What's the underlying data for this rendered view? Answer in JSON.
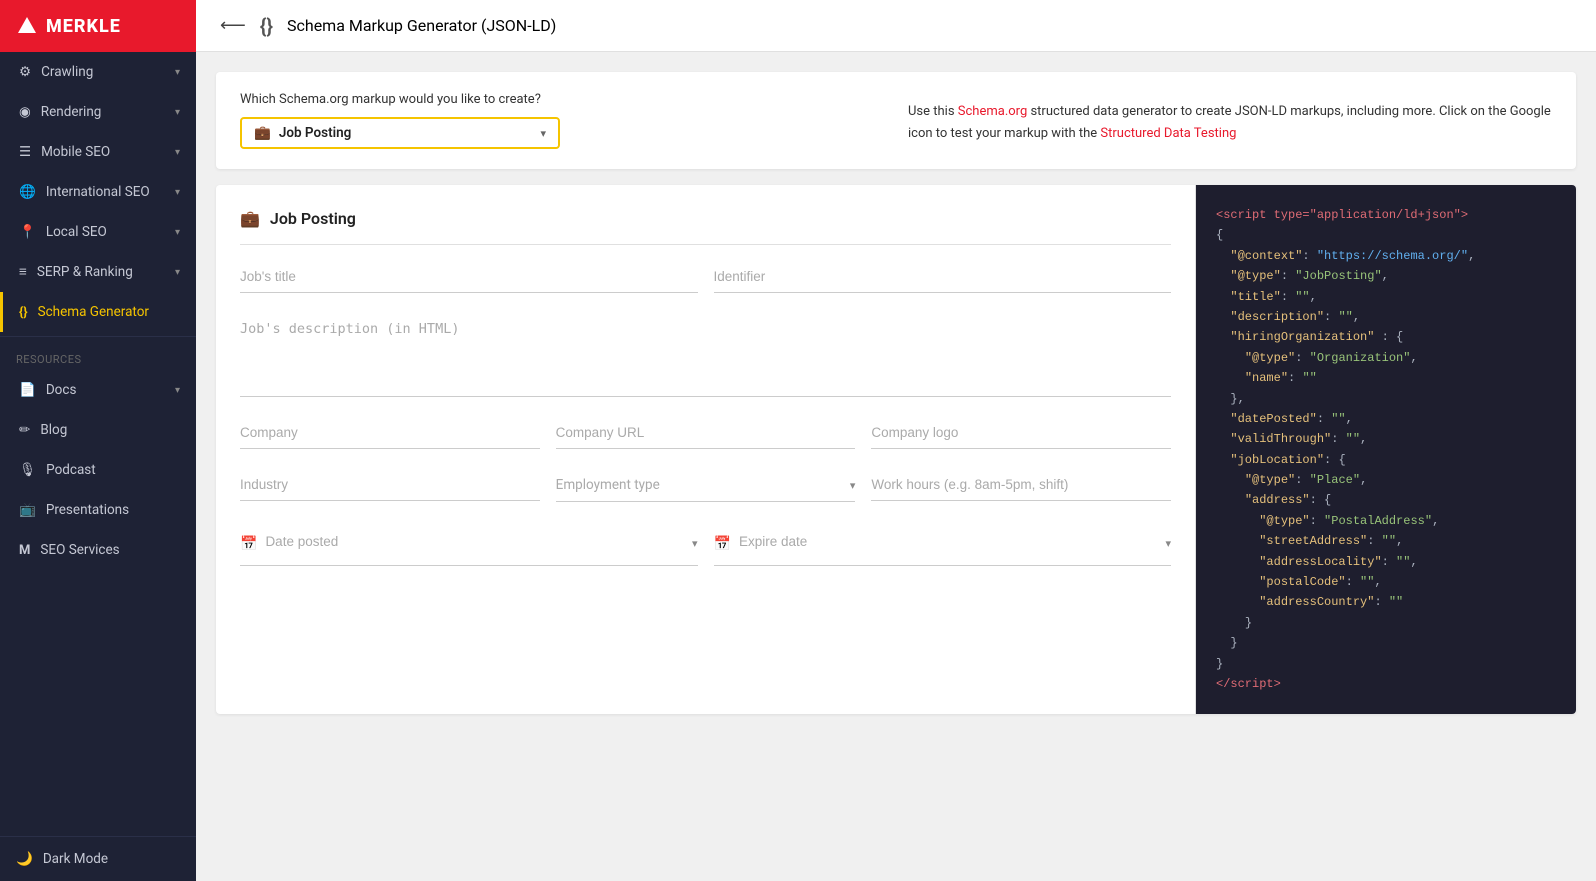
{
  "brand": {
    "name": "MERKLE",
    "logo_alt": "Merkle logo"
  },
  "sidebar": {
    "nav_items": [
      {
        "id": "crawling",
        "label": "Crawling",
        "icon": "cpu-icon",
        "has_chevron": true,
        "active": false
      },
      {
        "id": "rendering",
        "label": "Rendering",
        "icon": "eye-icon",
        "has_chevron": true,
        "active": false
      },
      {
        "id": "mobile-seo",
        "label": "Mobile SEO",
        "icon": "phone-icon",
        "has_chevron": true,
        "active": false
      },
      {
        "id": "international-seo",
        "label": "International SEO",
        "icon": "globe-icon",
        "has_chevron": true,
        "active": false
      },
      {
        "id": "local-seo",
        "label": "Local SEO",
        "icon": "pin-icon",
        "has_chevron": true,
        "active": false
      },
      {
        "id": "serp-ranking",
        "label": "SERP & Ranking",
        "icon": "list-icon",
        "has_chevron": true,
        "active": false
      },
      {
        "id": "schema-generator",
        "label": "Schema Generator",
        "icon": "schema-icon",
        "has_chevron": false,
        "active": true
      }
    ],
    "resources_label": "Resources",
    "resources_items": [
      {
        "id": "docs",
        "label": "Docs",
        "icon": "docs-icon",
        "has_chevron": true
      },
      {
        "id": "blog",
        "label": "Blog",
        "icon": "blog-icon",
        "has_chevron": false
      },
      {
        "id": "podcast",
        "label": "Podcast",
        "icon": "mic-icon",
        "has_chevron": false
      },
      {
        "id": "presentations",
        "label": "Presentations",
        "icon": "present-icon",
        "has_chevron": false
      },
      {
        "id": "seo-services",
        "label": "SEO Services",
        "icon": "seo-icon",
        "has_chevron": false
      }
    ],
    "dark_mode_label": "Dark Mode",
    "dark_mode_icon": "moon-icon"
  },
  "topbar": {
    "back_label": "⟵",
    "icon": "braces-icon",
    "title": "Schema Markup Generator (JSON-LD)"
  },
  "schema_selector": {
    "question": "Which Schema.org markup would you like to create?",
    "selected_value": "Job Posting",
    "icon": "briefcase-icon"
  },
  "info_text": {
    "part1": "Use this ",
    "link1": "Schema.org",
    "part2": " structured data generator to create JSON-LD markups, including more. Click on the Google icon to test your markup with the ",
    "link2": "Structured Data Testing"
  },
  "form": {
    "section_title": "Job Posting",
    "section_icon": "briefcase-icon",
    "fields": {
      "jobs_title_placeholder": "Job's title",
      "identifier_placeholder": "Identifier",
      "jobs_description_placeholder": "Job's description (in HTML)",
      "company_placeholder": "Company",
      "company_url_placeholder": "Company URL",
      "company_logo_placeholder": "Company logo",
      "industry_placeholder": "Industry",
      "employment_type_placeholder": "Employment type",
      "work_hours_placeholder": "Work hours (e.g. 8am-5pm, shift)",
      "date_posted_placeholder": "Date posted",
      "expire_date_placeholder": "Expire date"
    }
  },
  "json_output": {
    "script_open": "<script type=\"application/ld+json\">",
    "lines": [
      "{",
      "  \"@context\": \"https://schema.org/\",",
      "  \"@type\": \"JobPosting\",",
      "  \"title\": \"\",",
      "  \"description\": \"\",",
      "  \"hiringOrganization\" : {",
      "    \"@type\": \"Organization\",",
      "    \"name\": \"\"",
      "  },",
      "  \"datePosted\": \"\",",
      "  \"validThrough\": \"\",",
      "  \"jobLocation\": {",
      "    \"@type\": \"Place\",",
      "    \"address\": {",
      "      \"@type\": \"PostalAddress\",",
      "      \"streetAddress\": \"\",",
      "      \"addressLocality\": \"\",",
      "      \"postalCode\": \"\",",
      "      \"addressCountry\": \"\"",
      "    }",
      "  }",
      "}"
    ],
    "script_close": "</script>"
  }
}
